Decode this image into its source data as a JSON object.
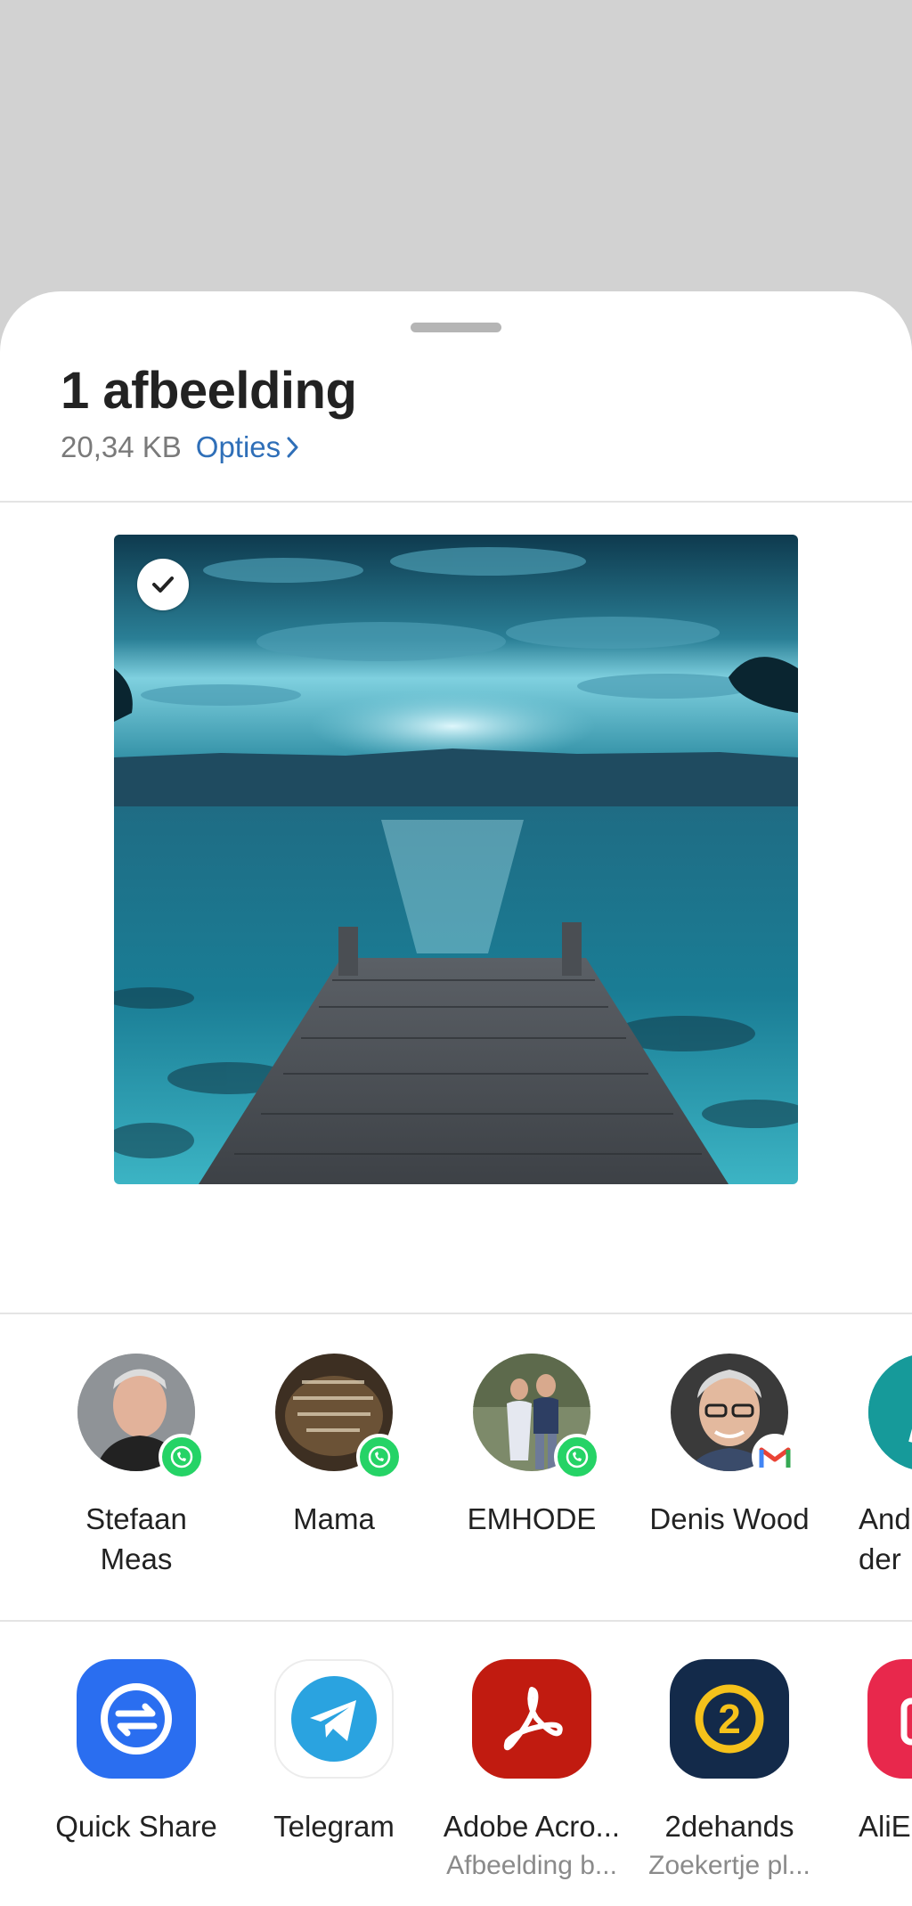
{
  "sheet": {
    "title": "1 afbeelding",
    "size": "20,34 KB",
    "options_label": "Opties"
  },
  "preview": {
    "selected": true,
    "icon": "check-icon"
  },
  "contacts": [
    {
      "name_line1": "Stefaan",
      "name_line2": "Meas",
      "app": "whatsapp-icon",
      "avatar_color": "#8a8a8a"
    },
    {
      "name_line1": "Mama",
      "name_line2": "",
      "app": "whatsapp-icon",
      "avatar_color": "#4a3a2a"
    },
    {
      "name_line1": "EMHODE",
      "name_line2": "",
      "app": "whatsapp-icon",
      "avatar_color": "#6b7a5c"
    },
    {
      "name_line1": "Denis Wood",
      "name_line2": "",
      "app": "gmail-icon",
      "avatar_color": "#5a5a5a"
    },
    {
      "name_line1": "And",
      "name_line2": "der",
      "app": "",
      "avatar_color": "#1a9c9c"
    }
  ],
  "apps": [
    {
      "name": "Quick Share",
      "sub": "",
      "icon": "quick-share-icon",
      "color": "#2a6ef0"
    },
    {
      "name": "Telegram",
      "sub": "",
      "icon": "telegram-icon",
      "color": "#2aa3e0"
    },
    {
      "name": "Adobe Acro...",
      "sub": "Afbeelding b...",
      "icon": "adobe-acrobat-icon",
      "color": "#c11b10"
    },
    {
      "name": "2dehands",
      "sub": "Zoekertje pl...",
      "icon": "2dehands-icon",
      "color": "#132a4a"
    },
    {
      "name": "AliE",
      "sub": "",
      "icon": "aliexpress-icon",
      "color": "#e8284c"
    }
  ],
  "colors": {
    "accent": "#2f6fb8",
    "whatsapp": "#25d366",
    "background_dim": "#d2d2d2"
  }
}
